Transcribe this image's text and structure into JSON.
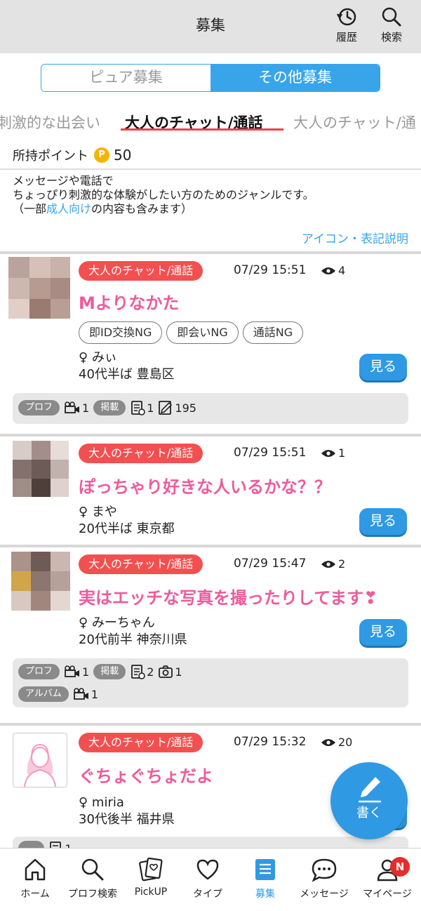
{
  "header": {
    "title": "募集",
    "history_label": "履歴",
    "search_label": "検索"
  },
  "toggle": {
    "left": "ピュア募集",
    "right": "その他募集",
    "selected": "その他募集"
  },
  "genre_tabs": [
    "刺激的な出会い",
    "大人のチャット/通話",
    "大人のチャット/通"
  ],
  "points": {
    "label": "所持ポイント",
    "badge": "P",
    "value": "50"
  },
  "description": {
    "line1": "メッセージや電話で",
    "line2": "ちょっぴり刺激的な体験がしたい方のためのジャンルです。",
    "line3_prefix": "（一部",
    "line3_link": "成人向け",
    "line3_suffix": "の内容も含みます）"
  },
  "legend_link": "アイコン・表記説明",
  "posts": [
    {
      "genre": "大人のチャット/通話",
      "time": "07/29 15:51",
      "views": "4",
      "title": "Mよりなかた",
      "ng_tags": [
        "即ID交換NG",
        "即会いNG",
        "通話NG"
      ],
      "gender": "♀",
      "name": "みぃ",
      "age_area": "40代半ば 豊島区",
      "see": "見る",
      "meta": {
        "prof": "プロフ",
        "video": "1",
        "keisai": "掲載",
        "board": "1",
        "diary": "195"
      }
    },
    {
      "genre": "大人のチャット/通話",
      "time": "07/29 15:51",
      "views": "1",
      "title": "ぽっちゃり好きな人いるかな？？",
      "gender": "♀",
      "name": "まや",
      "age_area": "20代半ば 東京都",
      "see": "見る"
    },
    {
      "genre": "大人のチャット/通話",
      "time": "07/29 15:47",
      "views": "2",
      "title": "実はエッチな写真を撮ったりしてます❣",
      "gender": "♀",
      "name": "みーちゃん",
      "age_area": "20代前半 神奈川県",
      "see": "見る",
      "meta": {
        "prof": "プロフ",
        "video": "1",
        "keisai": "掲載",
        "board": "2",
        "camera": "1",
        "album": "アルバム",
        "album_video": "1"
      }
    },
    {
      "genre": "大人のチャット/通話",
      "time": "07/29 15:32",
      "views": "20",
      "title": "ぐちょぐちょだよ",
      "gender": "♀",
      "name": "miria",
      "age_area": "30代後半 福井県",
      "meta_partial": "1"
    }
  ],
  "fab_label": "書く",
  "bottom_nav": [
    "ホーム",
    "プロフ検索",
    "PickUP",
    "タイプ",
    "募集",
    "メッセージ",
    "マイページ"
  ],
  "active_nav": "募集",
  "mypage_badge": "N",
  "colors": {
    "accent_blue": "#38a5ea",
    "genre_badge_red": "#f25050",
    "title_pink": "#ee5b9c",
    "point_gold": "#f6b400"
  }
}
